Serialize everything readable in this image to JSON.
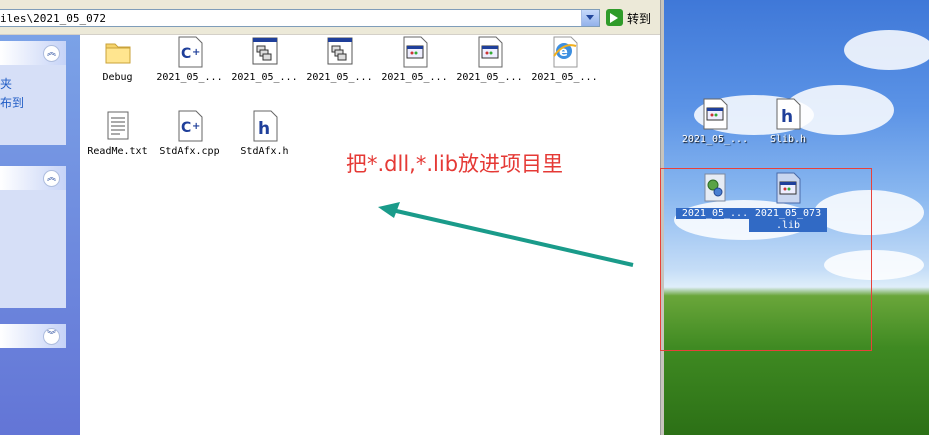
{
  "address_bar": {
    "path": "iles\\2021_05_072",
    "go_label": "转到"
  },
  "task_pane": {
    "links": [
      "夹",
      "布到"
    ]
  },
  "files": [
    {
      "label": "Debug",
      "icon": "folder-icon"
    },
    {
      "label": "2021_05_...",
      "icon": "cpp-file-icon"
    },
    {
      "label": "2021_05_...",
      "icon": "project-file-icon"
    },
    {
      "label": "2021_05_...",
      "icon": "project-file-icon"
    },
    {
      "label": "2021_05_...",
      "icon": "window-file-icon"
    },
    {
      "label": "2021_05_...",
      "icon": "window-file-icon"
    },
    {
      "label": "2021_05_...",
      "icon": "ie-icon"
    },
    {
      "label": "ReadMe.txt",
      "icon": "text-file-icon"
    },
    {
      "label": "StdAfx.cpp",
      "icon": "cpp-file-icon"
    },
    {
      "label": "StdAfx.h",
      "icon": "header-file-icon"
    }
  ],
  "desktop": {
    "items": [
      {
        "label": "2021_05_...",
        "icon": "window-file-icon"
      },
      {
        "label": "Slib.h",
        "icon": "header-file-icon"
      },
      {
        "label": "2021_05_...",
        "icon": "dll-gear-icon"
      },
      {
        "label": "2021_05_073",
        "label2": ".lib",
        "icon": "lib-file-icon"
      }
    ]
  },
  "annotation": {
    "text": "把*.dll,*.lib放进项目里",
    "color": "#e53935"
  },
  "colors": {
    "arrow": "#1a9b8a",
    "highlight_box": "#e8413a",
    "selection": "#316ac5"
  }
}
